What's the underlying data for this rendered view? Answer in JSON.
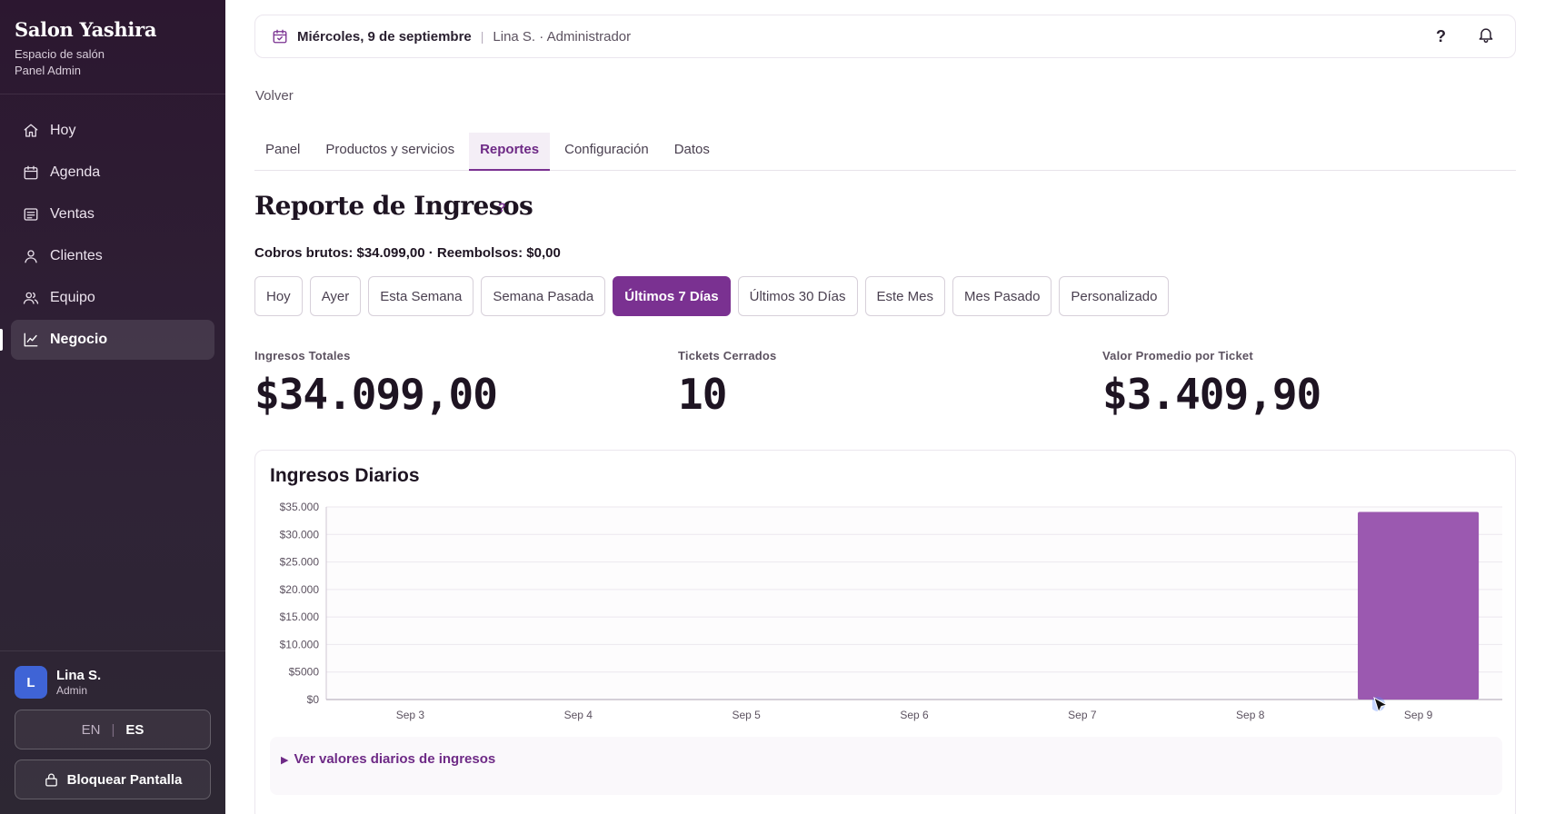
{
  "sidebar": {
    "brand": "Salon Yashira",
    "subtitle_1": "Espacio de salón",
    "subtitle_2": "Panel Admin",
    "items": [
      {
        "label": "Hoy",
        "icon": "home-icon"
      },
      {
        "label": "Agenda",
        "icon": "calendar-icon"
      },
      {
        "label": "Ventas",
        "icon": "receipt-icon"
      },
      {
        "label": "Clientes",
        "icon": "user-icon"
      },
      {
        "label": "Equipo",
        "icon": "users-icon"
      },
      {
        "label": "Negocio",
        "icon": "chart-icon",
        "active": true
      }
    ],
    "user": {
      "initial": "L",
      "name": "Lina S.",
      "role": "Admin"
    },
    "lang": {
      "en": "EN",
      "sep": "|",
      "es": "ES",
      "selected": "ES"
    },
    "lock_label": "Bloquear Pantalla"
  },
  "topbar": {
    "date": "Miércoles, 9 de septiembre",
    "divider": "|",
    "who": "Lina S. · Administrador",
    "help": "?"
  },
  "back_label": "Volver",
  "tabs": [
    {
      "label": "Panel"
    },
    {
      "label": "Productos y servicios"
    },
    {
      "label": "Reportes",
      "active": true
    },
    {
      "label": "Configuración"
    },
    {
      "label": "Datos"
    }
  ],
  "report": {
    "title": "Reporte de Ingresos",
    "help": "?",
    "summary": "Cobros brutos: $34.099,00 · Reembolsos: $0,00"
  },
  "filters": [
    {
      "label": "Hoy"
    },
    {
      "label": "Ayer"
    },
    {
      "label": "Esta Semana"
    },
    {
      "label": "Semana Pasada"
    },
    {
      "label": "Últimos 7 Días",
      "active": true
    },
    {
      "label": "Últimos 30 Días"
    },
    {
      "label": "Este Mes"
    },
    {
      "label": "Mes Pasado"
    },
    {
      "label": "Personalizado"
    }
  ],
  "metrics": [
    {
      "label": "Ingresos Totales",
      "value": "$34.099,00"
    },
    {
      "label": "Tickets Cerrados",
      "value": "10"
    },
    {
      "label": "Valor Promedio por Ticket",
      "value": "$3.409,90"
    }
  ],
  "chart_card": {
    "details_label": "Ver valores diarios de ingresos"
  },
  "colors": {
    "accent": "#7a3191",
    "bar": "#9b59b0",
    "sidebar": "#2c1730"
  },
  "chart_data": {
    "type": "bar",
    "title": "Ingresos Diarios",
    "categories": [
      "Sep 3",
      "Sep 4",
      "Sep 5",
      "Sep 6",
      "Sep 7",
      "Sep 8",
      "Sep 9"
    ],
    "values": [
      0,
      0,
      0,
      0,
      0,
      0,
      34099
    ],
    "ylim": [
      0,
      35000
    ],
    "yticks": [
      0,
      5000,
      10000,
      15000,
      20000,
      25000,
      30000,
      35000
    ],
    "ytick_labels": [
      "$0",
      "$5000",
      "$10.000",
      "$15.000",
      "$20.000",
      "$25.000",
      "$30.000",
      "$35.000"
    ],
    "xlabel": "",
    "ylabel": "",
    "grid": true
  }
}
